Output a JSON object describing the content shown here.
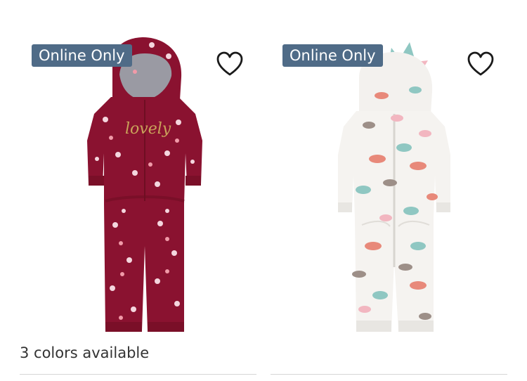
{
  "products": [
    {
      "badge": "Online Only",
      "colors_text": "3 colors available",
      "image_subject": "burgundy floral hooded jumpsuit with 'lovely' script",
      "heart_icon": "heart-outline-icon"
    },
    {
      "badge": "Online Only",
      "colors_text": "",
      "image_subject": "white fleece dinosaur print hooded jumpsuit with spikes",
      "heart_icon": "heart-outline-icon"
    }
  ],
  "colors": {
    "badge_bg": "#4f6b87",
    "badge_text": "#ffffff",
    "divider": "#d6d6d6"
  }
}
